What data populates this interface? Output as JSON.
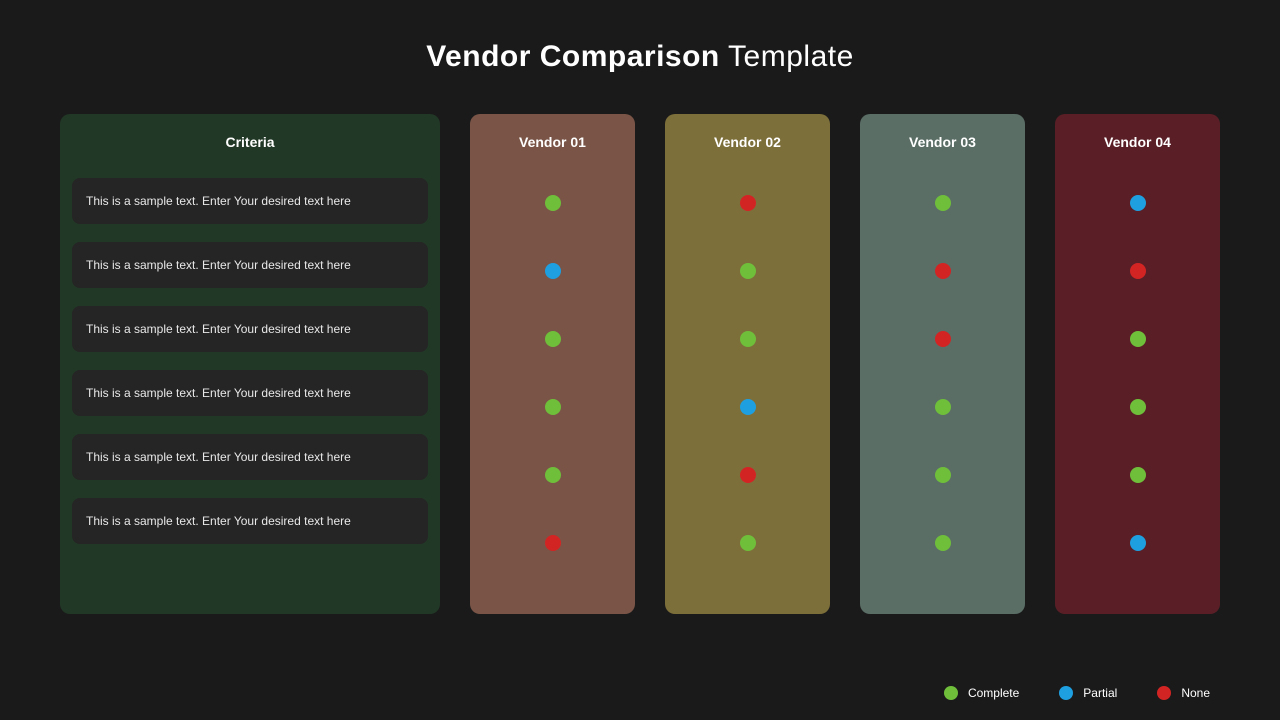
{
  "title_bold": "Vendor Comparison",
  "title_rest": "Template",
  "criteria_header": "Criteria",
  "criteria": [
    "This is a sample text. Enter Your desired text here",
    "This is a sample text. Enter Your desired text here",
    "This is a sample text. Enter Your desired text here",
    "This is a sample text. Enter Your desired text here",
    "This is a sample text. Enter Your desired text here",
    "This is a sample text. Enter Your desired text here"
  ],
  "vendors": [
    {
      "name": "Vendor 01",
      "statuses": [
        "complete",
        "partial",
        "complete",
        "complete",
        "complete",
        "none"
      ]
    },
    {
      "name": "Vendor 02",
      "statuses": [
        "none",
        "complete",
        "complete",
        "partial",
        "none",
        "complete"
      ]
    },
    {
      "name": "Vendor 03",
      "statuses": [
        "complete",
        "none",
        "none",
        "complete",
        "complete",
        "complete"
      ]
    },
    {
      "name": "Vendor 04",
      "statuses": [
        "partial",
        "none",
        "complete",
        "complete",
        "complete",
        "partial"
      ]
    }
  ],
  "legend": {
    "complete": "Complete",
    "partial": "Partial",
    "none": "None"
  },
  "status_colors": {
    "complete": "#6fbf3b",
    "partial": "#1e9fe0",
    "none": "#d32424"
  }
}
